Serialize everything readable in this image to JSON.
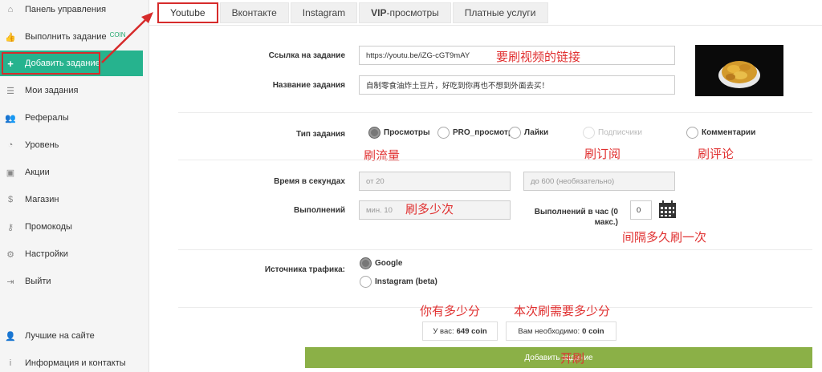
{
  "sidebar": {
    "items": [
      {
        "label": "Панель управления",
        "icon": "home-icon",
        "glyph": "⌂"
      },
      {
        "label": "Выполнить задание",
        "icon": "thumbs-up-icon",
        "glyph": "👍",
        "badge": "COIN"
      },
      {
        "label": "Добавить задание",
        "icon": "plus-icon",
        "glyph": "+",
        "active": true
      },
      {
        "label": "Мои задания",
        "icon": "list-icon",
        "glyph": "☰"
      },
      {
        "label": "Рефералы",
        "icon": "users-icon",
        "glyph": "👥"
      },
      {
        "label": "Уровень",
        "icon": "gauge-icon",
        "glyph": "◔"
      },
      {
        "label": "Акции",
        "icon": "gift-icon",
        "glyph": "▣"
      },
      {
        "label": "Магазин",
        "icon": "dollar-icon",
        "glyph": "$"
      },
      {
        "label": "Промокоды",
        "icon": "key-icon",
        "glyph": "⚷"
      },
      {
        "label": "Настройки",
        "icon": "gear-icon",
        "glyph": "⚙"
      },
      {
        "label": "Выйти",
        "icon": "logout-icon",
        "glyph": "⇥"
      },
      {
        "label": "Лучшие на сайте",
        "icon": "user-icon",
        "glyph": "👤"
      },
      {
        "label": "Информация и контакты",
        "icon": "info-icon",
        "glyph": "i"
      }
    ]
  },
  "tabs": [
    {
      "label": "Youtube",
      "active": true
    },
    {
      "label": "Вконтакте"
    },
    {
      "label": "Instagram"
    },
    {
      "label": "VIP",
      "rest": "-просмотры",
      "bold": true
    },
    {
      "label": "Платные услуги"
    }
  ],
  "form": {
    "link_label": "Ссылка на задание",
    "link_value": "https://youtu.be/iZG-cGT9mAY",
    "link_note": "要刷视频的链接",
    "name_label": "Название задания",
    "name_value": "自制零食油炸土豆片，好吃到你再也不想到外面去买！",
    "type_label": "Тип задания",
    "types": [
      {
        "label": "Просмотры",
        "checked": true
      },
      {
        "label": "PRO_просмотр"
      },
      {
        "label": "Лайки"
      },
      {
        "label": "Подписчики",
        "disabled": true
      },
      {
        "label": "Комментарии"
      }
    ],
    "type_notes": [
      "刷流量",
      "刷订阅",
      "刷评论"
    ],
    "time_label": "Время в секундах",
    "time_from_placeholder": "от 20",
    "time_to_placeholder": "до 600 (необязательно)",
    "exec_label": "Выполнений",
    "exec_placeholder": "мин. 10",
    "exec_note": "刷多少次",
    "per_hour_label": "Выполнений в час (0 макс.)",
    "per_hour_value": "0",
    "per_hour_note": "间隔多久刷一次",
    "traffic_label": "Источника трафика:",
    "traffic": [
      {
        "label": "Google",
        "checked": true
      },
      {
        "label": "Instagram (beta)"
      }
    ]
  },
  "summary": {
    "have_note": "你有多少分",
    "need_note": "本次刷需要多少分",
    "have_prefix": "У вас:",
    "have_value": "649 coin",
    "need_prefix": "Вам необходимо:",
    "need_value": "0 coin"
  },
  "submit": {
    "label": "Добавить задание",
    "note": "开刷"
  },
  "colors": {
    "accent": "#26b38e",
    "annotation": "#d62b2b",
    "submit": "#8bb047"
  }
}
